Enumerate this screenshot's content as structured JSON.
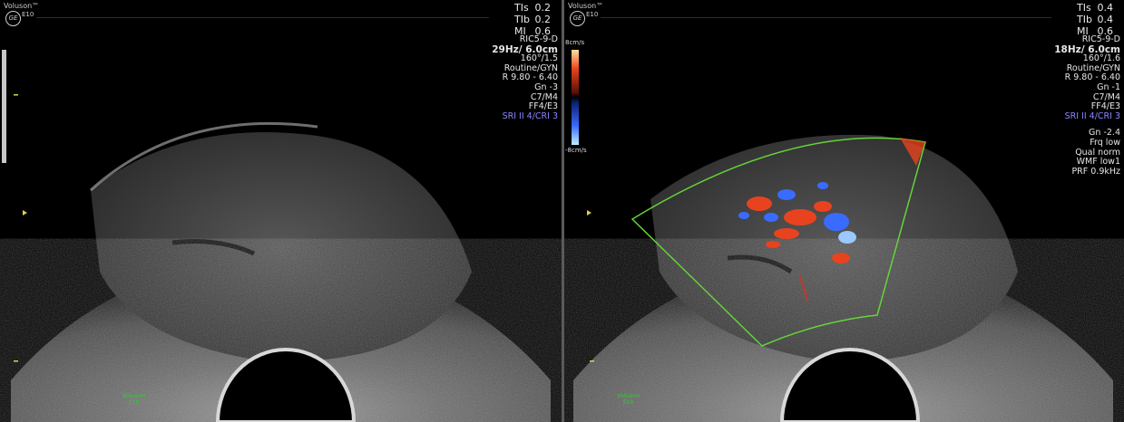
{
  "left": {
    "brand": "Voluson™",
    "model_small": "E10",
    "safety": [
      {
        "label": "TIs",
        "value": "0.2"
      },
      {
        "label": "TIb",
        "value": "0.2"
      },
      {
        "label": "MI",
        "value": "0.6"
      }
    ],
    "probe": "RIC5-9-D",
    "rate_depth": "29Hz/ 6.0cm",
    "angle": "160°/1.5",
    "preset": "Routine/GYN",
    "range": "R 9.80 - 6.40",
    "gain": "Gn  -3",
    "map": "C7/M4",
    "ff": "FF4/E3",
    "sri": "SRI II 4/CRI 3",
    "footer_brand": "Voluson",
    "footer_model": "E10"
  },
  "right": {
    "brand": "Voluson™",
    "model_small": "E10",
    "safety": [
      {
        "label": "TIs",
        "value": "0.4"
      },
      {
        "label": "TIb",
        "value": "0.4"
      },
      {
        "label": "MI",
        "value": "0.6"
      }
    ],
    "probe": "RIC5-9-D",
    "rate_depth": "18Hz/ 6.0cm",
    "angle": "160°/1.6",
    "preset": "Routine/GYN",
    "range": "R 9.80 - 6.40",
    "gain": "Gn  -1",
    "map": "C7/M4",
    "ff": "FF4/E3",
    "sri": "SRI II 4/CRI 3",
    "color_gain": "Gn -2.4",
    "frq": "Frq low",
    "qual": "Qual norm",
    "wmf": "WMF low1",
    "prf": "PRF  0.9kHz",
    "scale_top": "8cm/s",
    "scale_bottom": "-8cm/s",
    "footer_brand": "Voluson",
    "footer_model": "E10"
  },
  "colors": {
    "color_box": "#66d33a",
    "doppler_red": "#e8431e",
    "doppler_blue": "#3a6bff",
    "footer_text": "#2fd12f",
    "sri_text": "#8a86ff"
  }
}
